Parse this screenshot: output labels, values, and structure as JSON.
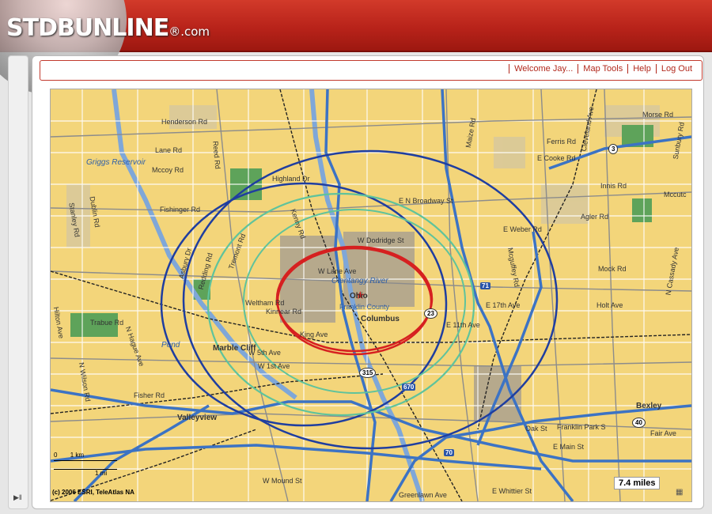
{
  "app": {
    "logo_main": "STDB",
    "logo_rest": "UNLINE",
    "logo_suffix": "®.com"
  },
  "nav": {
    "welcome": "Welcome Jay...",
    "map_tools": "Map Tools",
    "help": "Help",
    "logout": "Log Out"
  },
  "map": {
    "labels": {
      "henderson": "Henderson Rd",
      "lane": "Lane Rd",
      "griggs": "Griggs Reservoir",
      "mccoy": "Mccoy Rd",
      "fishinger": "Fishinger Rd",
      "highland": "Highland Dr",
      "dodridge": "W Dodridge St",
      "broadway": "E N Broadway St",
      "lanew": "W Lane Ave",
      "olentangy": "Olentangy River",
      "ohio": "Ohio",
      "franklin": "Franklin County",
      "columbus": "Columbus",
      "weltham": "Weltham Rd",
      "kinnear": "Kinnear Rd",
      "kingave": "King Ave",
      "w5th": "W 5th Ave",
      "w1st": "W 1st Ave",
      "marblecliff": "Marble Cliff",
      "valleyview": "Valleyview",
      "trabue": "Trabue Rd",
      "pond": "Pond",
      "e17th": "E 17th Ave",
      "e11th": "E 11th Ave",
      "holt": "Holt Ave",
      "mock": "Mock Rd",
      "agler": "Agler Rd",
      "eweber": "E Weber Rd",
      "innis": "Innis Rd",
      "ecooke": "E Cooke Rd",
      "ferris": "Ferris Rd",
      "morse": "Morse Rd",
      "mccutcheon": "Mccutc",
      "bexley": "Bexley",
      "oak": "Oak St",
      "franklinpark": "Franklin Park S",
      "emain": "E Main St",
      "fair": "Fair Ave",
      "wmound": "W Mound St",
      "whittier": "E Whittier St",
      "greenlawn": "Greenlawn Ave",
      "tremont": "Tremont Rd",
      "kenny": "Kenny Rd",
      "dublin": "Dublin Rd",
      "stanley": "Stanley Rd",
      "reed": "Reed Rd",
      "asbury": "Asbury Dr",
      "redding": "Redding Rd",
      "maize": "Maize Rd",
      "cleveland": "Cleveland Ave",
      "sunbury": "Sunbury Rd",
      "mcguffey": "Mcguffey Rd",
      "ncassady": "N Cassady Ave",
      "hiltonia": "Hilton Ave",
      "nwilson": "N Wilson Rd",
      "nhague": "N Hague Ave",
      "fisher": "Fisher Rd"
    },
    "shields": {
      "i71": "71",
      "i670": "670",
      "i70": "70",
      "us23": "23",
      "sr315": "315",
      "sr3": "3",
      "us40": "40"
    },
    "scale_km": "1 km",
    "scale_mi": "1 mi",
    "scale_zero": "0",
    "copyright": "(c) 2006 ESRI, TeleAtlas NA",
    "radius_label": "7.4 miles"
  },
  "colors": {
    "brand_red": "#b8231a",
    "ring_inner": "#d62020",
    "ring_middle": "#5fc39c",
    "ring_outer": "#1f3ea0",
    "highway": "#3c73c4"
  },
  "icons": {
    "site": "star-icon",
    "sidebar_toggle": "expand-arrow-icon"
  }
}
